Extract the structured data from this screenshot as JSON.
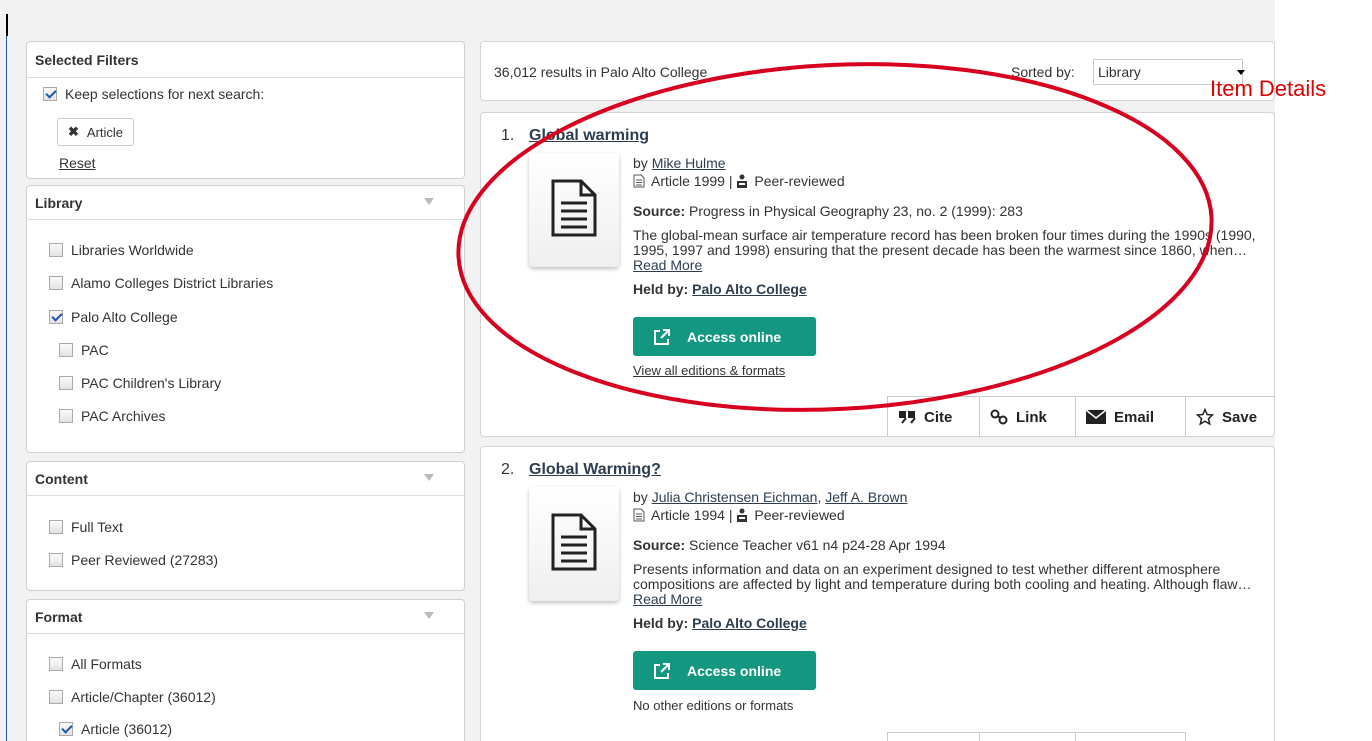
{
  "filters": {
    "selected": {
      "header": "Selected Filters",
      "keep_label": "Keep selections for next search:",
      "chip_label": "Article",
      "reset_label": "Reset"
    },
    "library": {
      "header": "Library",
      "items": [
        {
          "label": "Libraries Worldwide",
          "checked": false
        },
        {
          "label": "Alamo Colleges District Libraries",
          "checked": false
        },
        {
          "label": "Palo Alto College",
          "checked": true
        },
        {
          "label": "PAC",
          "checked": false
        },
        {
          "label": "PAC Children's Library",
          "checked": false
        },
        {
          "label": "PAC Archives",
          "checked": false
        }
      ]
    },
    "content": {
      "header": "Content",
      "items": [
        {
          "label": "Full Text",
          "checked": false
        },
        {
          "label": "Peer Reviewed (27283)",
          "checked": false
        }
      ]
    },
    "format": {
      "header": "Format",
      "items": [
        {
          "label": "All Formats",
          "checked": false
        },
        {
          "label": "Article/Chapter (36012)",
          "checked": false
        },
        {
          "label": "Article (36012)",
          "checked": true
        }
      ]
    }
  },
  "results": {
    "count_text": "36,012 results in Palo Alto College",
    "sort_label": "Sorted by:",
    "sort_value": "Library",
    "items": [
      {
        "number": "1.",
        "title": "Global warming",
        "by_prefix": "by",
        "author": "Mike Hulme",
        "format": "Article 1999 |",
        "peer": "Peer-reviewed",
        "source_label": "Source:",
        "source": "Progress in Physical Geography 23, no. 2 (1999): 283",
        "abstract": "The global-mean surface air temperature record has been broken four times during the 1990s (1990, 1995, 1997 and 1998) ensuring that the present decade has been the warmest since 1860, when…",
        "read_more": "Read More",
        "held_label": "Held by:",
        "held": "Palo Alto College",
        "access": "Access online",
        "editions": "View all editions & formats"
      },
      {
        "number": "2.",
        "title": "Global Warming?",
        "by_prefix": "by",
        "author": "Julia Christensen Eichman",
        "author2": "Jeff A. Brown",
        "format": "Article 1994 |",
        "peer": "Peer-reviewed",
        "source_label": "Source:",
        "source": "Science Teacher v61 n4 p24-28 Apr 1994",
        "abstract": "Presents information and data on an experiment designed to test whether different atmosphere compositions are affected by light and temperature during both cooling and heating. Although flaw…",
        "read_more": "Read More",
        "held_label": "Held by:",
        "held": "Palo Alto College",
        "access": "Access online",
        "editions": "No other editions or formats"
      }
    ],
    "tools": {
      "cite": "Cite",
      "link": "Link",
      "email": "Email",
      "save": "Save"
    }
  },
  "annotation": {
    "label": "Item Details",
    "color": "#e00000"
  }
}
